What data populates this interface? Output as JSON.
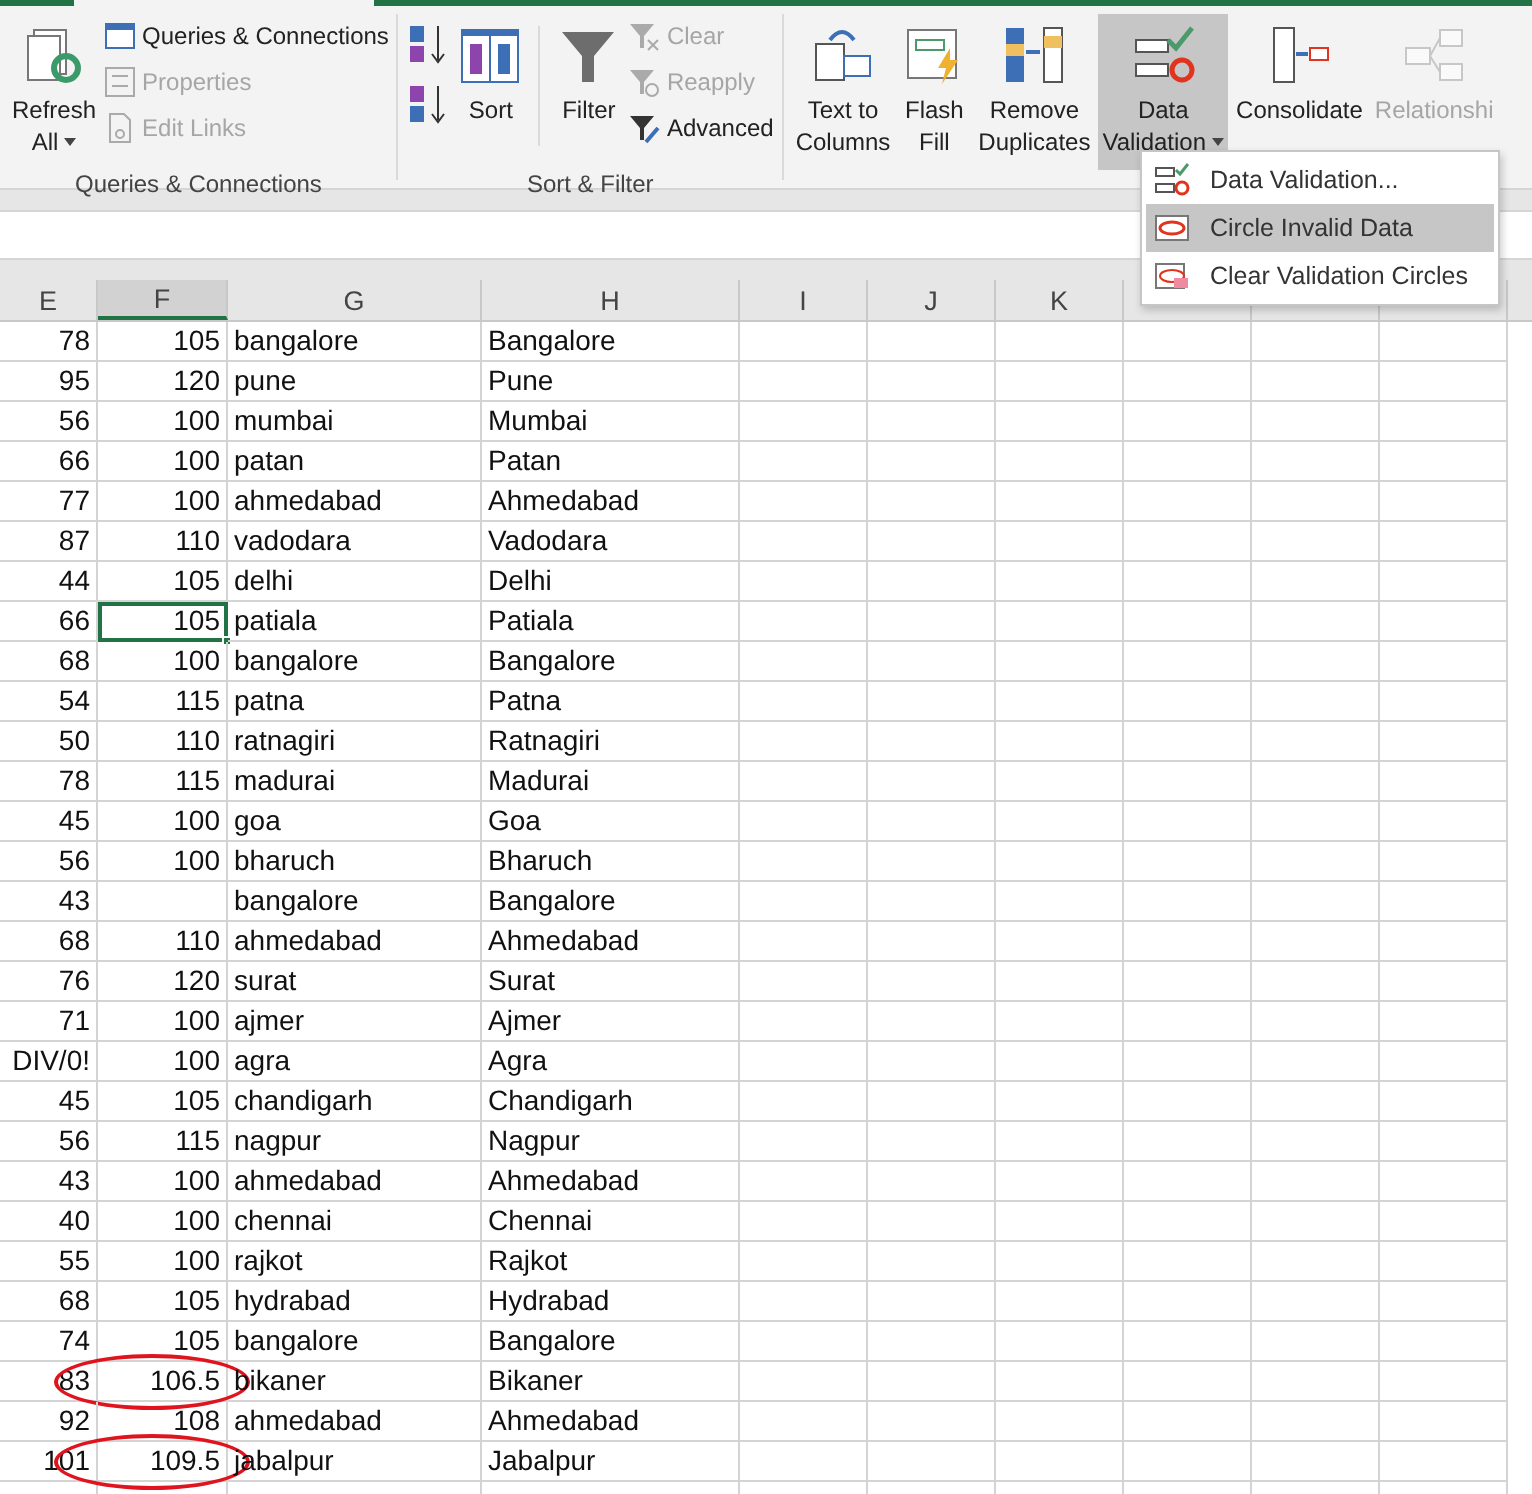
{
  "ribbon": {
    "groups": [
      {
        "label": "Queries & Connections",
        "large": [
          {
            "kind": "refresh",
            "label": "Refresh",
            "label2": "All",
            "dropdown": true,
            "disabled": false,
            "selected": false
          }
        ],
        "small": [
          {
            "kind": "queries",
            "label": "Queries & Connections",
            "disabled": false
          },
          {
            "kind": "properties",
            "label": "Properties",
            "disabled": true
          },
          {
            "kind": "links",
            "label": "Edit Links",
            "disabled": true
          }
        ]
      },
      {
        "label": "Sort & Filter",
        "sortButtons": [
          {
            "kind": "az"
          },
          {
            "kind": "za"
          }
        ],
        "large": [
          {
            "kind": "sort",
            "label": "Sort",
            "disabled": false,
            "selected": false
          },
          {
            "kind": "filter",
            "label": "Filter",
            "disabled": false,
            "selected": false
          }
        ],
        "small": [
          {
            "kind": "clear",
            "label": "Clear",
            "disabled": true
          },
          {
            "kind": "reapply",
            "label": "Reapply",
            "disabled": true
          },
          {
            "kind": "advanced",
            "label": "Advanced",
            "disabled": false
          }
        ]
      },
      {
        "large": [
          {
            "kind": "textcols",
            "label": "Text to",
            "label2": "Columns",
            "disabled": false,
            "selected": false
          },
          {
            "kind": "flash",
            "label": "Flash",
            "label2": "Fill",
            "disabled": false,
            "selected": false
          },
          {
            "kind": "dupes",
            "label": "Remove",
            "label2": "Duplicates",
            "disabled": false,
            "selected": false
          },
          {
            "kind": "validation",
            "label": "Data",
            "label2": "Validation",
            "dropdown": true,
            "disabled": false,
            "selected": true
          },
          {
            "kind": "consolidate",
            "label": "Consolidate",
            "disabled": false,
            "selected": false
          },
          {
            "kind": "relationships",
            "label": "Relationshi",
            "disabled": true,
            "selected": false
          }
        ]
      }
    ]
  },
  "menu": {
    "items": [
      {
        "kind": "validation",
        "label": "Data Validation...",
        "selected": false
      },
      {
        "kind": "circle",
        "label": "Circle Invalid Data",
        "selected": true
      },
      {
        "kind": "clearcircles",
        "label": "Clear Validation Circles",
        "selected": false
      }
    ]
  },
  "columns": [
    {
      "label": "E",
      "selected": false
    },
    {
      "label": "F",
      "selected": true
    },
    {
      "label": "G",
      "selected": false
    },
    {
      "label": "H",
      "selected": false
    },
    {
      "label": "I",
      "selected": false
    },
    {
      "label": "J",
      "selected": false
    },
    {
      "label": "K",
      "selected": false
    }
  ],
  "rows": [
    {
      "e": "78",
      "f": "105",
      "g": "bangalore",
      "h": "Bangalore",
      "circled": false,
      "selected": false
    },
    {
      "e": "95",
      "f": "120",
      "g": "pune",
      "h": "Pune",
      "circled": false,
      "selected": false
    },
    {
      "e": "56",
      "f": "100",
      "g": "mumbai",
      "h": "Mumbai",
      "circled": false,
      "selected": false
    },
    {
      "e": "66",
      "f": "100",
      "g": "patan",
      "h": "Patan",
      "circled": false,
      "selected": false
    },
    {
      "e": "77",
      "f": "100",
      "g": "ahmedabad",
      "h": "Ahmedabad",
      "circled": false,
      "selected": false
    },
    {
      "e": "87",
      "f": "110",
      "g": "vadodara",
      "h": "Vadodara",
      "circled": false,
      "selected": false
    },
    {
      "e": "44",
      "f": "105",
      "g": "delhi",
      "h": "Delhi",
      "circled": false,
      "selected": false
    },
    {
      "e": "66",
      "f": "105",
      "g": "patiala",
      "h": "Patiala",
      "circled": false,
      "selected": true
    },
    {
      "e": "68",
      "f": "100",
      "g": "bangalore",
      "h": "Bangalore",
      "circled": false,
      "selected": false
    },
    {
      "e": "54",
      "f": "115",
      "g": "patna",
      "h": "Patna",
      "circled": false,
      "selected": false
    },
    {
      "e": "50",
      "f": "110",
      "g": "ratnagiri",
      "h": "Ratnagiri",
      "circled": false,
      "selected": false
    },
    {
      "e": "78",
      "f": "115",
      "g": "madurai",
      "h": "Madurai",
      "circled": false,
      "selected": false
    },
    {
      "e": "45",
      "f": "100",
      "g": "goa",
      "h": "Goa",
      "circled": false,
      "selected": false
    },
    {
      "e": "56",
      "f": "100",
      "g": "bharuch",
      "h": "Bharuch",
      "circled": false,
      "selected": false
    },
    {
      "e": "43",
      "g": "bangalore",
      "h": "Bangalore",
      "circled": false,
      "selected": false
    },
    {
      "e": "68",
      "f": "110",
      "g": "ahmedabad",
      "h": "Ahmedabad",
      "circled": false,
      "selected": false
    },
    {
      "e": "76",
      "f": "120",
      "g": "surat",
      "h": "Surat",
      "circled": false,
      "selected": false
    },
    {
      "e": "71",
      "f": "100",
      "g": "ajmer",
      "h": "Ajmer",
      "circled": false,
      "selected": false
    },
    {
      "e": "DIV/0!",
      "f": "100",
      "g": "agra",
      "h": "Agra",
      "circled": false,
      "selected": false
    },
    {
      "e": "45",
      "f": "105",
      "g": "chandigarh",
      "h": "Chandigarh",
      "circled": false,
      "selected": false
    },
    {
      "e": "56",
      "f": "115",
      "g": "nagpur",
      "h": "Nagpur",
      "circled": false,
      "selected": false
    },
    {
      "e": "43",
      "f": "100",
      "g": "ahmedabad",
      "h": "Ahmedabad",
      "circled": false,
      "selected": false
    },
    {
      "e": "40",
      "f": "100",
      "g": "chennai",
      "h": "Chennai",
      "circled": false,
      "selected": false
    },
    {
      "e": "55",
      "f": "100",
      "g": "rajkot",
      "h": "Rajkot",
      "circled": false,
      "selected": false
    },
    {
      "e": "68",
      "f": "105",
      "g": "hydrabad",
      "h": "Hydrabad",
      "circled": false,
      "selected": false
    },
    {
      "e": "74",
      "f": "105",
      "g": "bangalore",
      "h": "Bangalore",
      "circled": false,
      "selected": false
    },
    {
      "e": "83",
      "f": "106.5",
      "g": "bikaner",
      "h": "Bikaner",
      "circled": true,
      "selected": false
    },
    {
      "e": "92",
      "f": "108",
      "g": "ahmedabad",
      "h": "Ahmedabad",
      "circled": false,
      "selected": false
    },
    {
      "e": "101",
      "f": "109.5",
      "g": "jabalpur",
      "h": "Jabalpur",
      "circled": true,
      "selected": false
    }
  ]
}
